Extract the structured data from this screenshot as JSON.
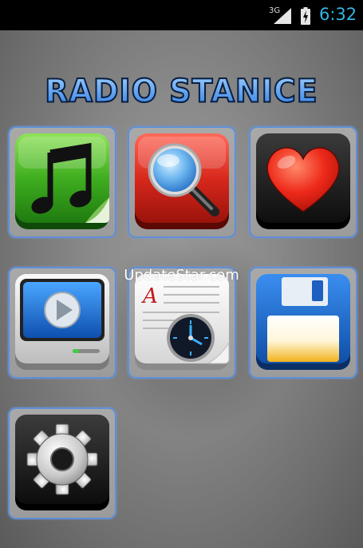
{
  "status_bar": {
    "network": "3G",
    "time": "6:32",
    "clock_color": "#33b5e5"
  },
  "title": "RADIO STANICE",
  "watermark": "UpdateStar.com",
  "tiles": [
    {
      "icon": "music-note-icon",
      "color": "#3fae1f"
    },
    {
      "icon": "magnifier-icon",
      "color": "#d8281c"
    },
    {
      "icon": "heart-icon",
      "color": "#ee2a1a"
    },
    {
      "icon": "play-screen-icon",
      "color": "#1e78d8"
    },
    {
      "icon": "document-clock-icon",
      "color": "#eeeeee"
    },
    {
      "icon": "floppy-disk-icon",
      "color": "#1967c9"
    },
    {
      "icon": "gear-icon",
      "color": "#222222"
    }
  ],
  "colors": {
    "tile_border": "#5f8fd6",
    "title_fill": "#5aa8ff"
  }
}
